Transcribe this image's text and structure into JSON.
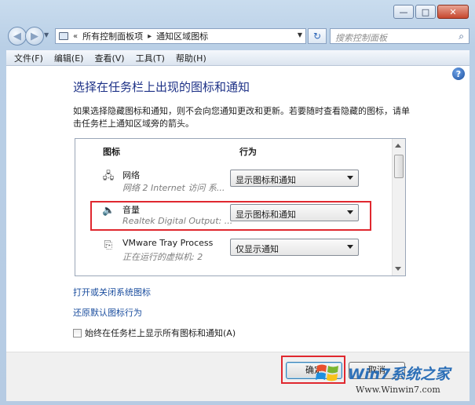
{
  "window": {
    "min_label": "—",
    "max_label": "□",
    "close_label": "✕"
  },
  "nav": {
    "address": {
      "root_chevron": "«",
      "crumbs": [
        "所有控制面板项",
        "通知区域图标"
      ],
      "separator": "▸"
    },
    "search_placeholder": "搜索控制面板"
  },
  "menu": [
    "文件(F)",
    "编辑(E)",
    "查看(V)",
    "工具(T)",
    "帮助(H)"
  ],
  "page": {
    "title": "选择在任务栏上出现的图标和通知",
    "description": "如果选择隐藏图标和通知，则不会向您通知更改和更新。若要随时查看隐藏的图标，请单击任务栏上通知区域旁的箭头。"
  },
  "list": {
    "col_icon": "图标",
    "col_behavior": "行为",
    "rows": [
      {
        "icon": "network-icon",
        "name": "网络",
        "sub": "网络 2 Internet 访问 系...",
        "behavior": "显示图标和通知"
      },
      {
        "icon": "speaker-icon",
        "name": "音量",
        "sub": "Realtek Digital Output: ...",
        "behavior": "显示图标和通知"
      },
      {
        "icon": "vmware-icon",
        "name": "VMware Tray Process",
        "sub": "正在运行的虚拟机: 2",
        "behavior": "仅显示通知"
      }
    ]
  },
  "links": {
    "system_icons": "打开或关闭系统图标",
    "restore": "还原默认图标行为"
  },
  "checkbox_label": "始终在任务栏上显示所有图标和通知(A)",
  "buttons": {
    "ok": "确定",
    "cancel": "取消"
  },
  "watermark": {
    "brand": "Win7系统之家",
    "url": "Www.Winwin7.com"
  },
  "colors": {
    "highlight": "#e0282f",
    "title": "#1e3287",
    "link": "#1a4d9e"
  }
}
